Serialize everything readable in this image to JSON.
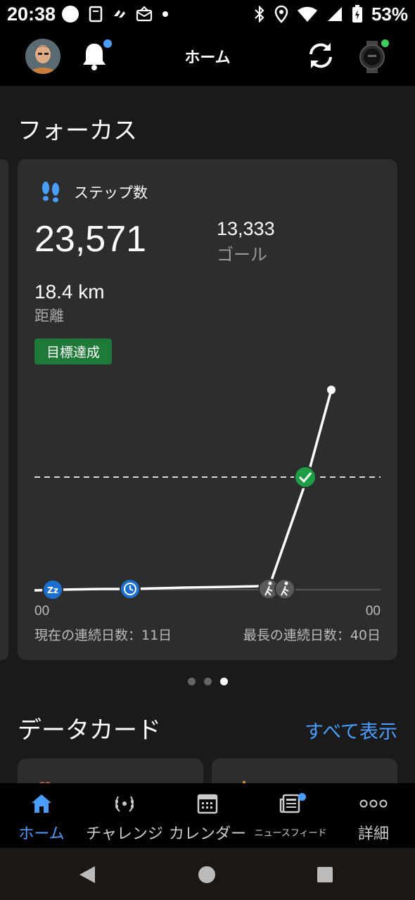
{
  "status_bar": {
    "time": "20:38",
    "battery": "53%"
  },
  "app_bar": {
    "title": "ホーム"
  },
  "focus": {
    "section_title": "フォーカス",
    "card": {
      "label": "ステップ数",
      "steps": "23,571",
      "goal_value": "13,333",
      "goal_label": "ゴール",
      "distance_value": "18.4 km",
      "distance_label": "距離",
      "badge": "目標達成",
      "tick_start": "00",
      "tick_end": "00",
      "current_streak": "現在の連続日数：11日",
      "longest_streak": "最長の連続日数：40日"
    },
    "pager": {
      "count": 3,
      "active": 2
    }
  },
  "data_cards": {
    "section_title": "データカード",
    "see_all": "すべて表示"
  },
  "bottom_nav": [
    {
      "label": "ホーム",
      "icon": "home-icon",
      "active": true
    },
    {
      "label": "チャレンジ",
      "icon": "laurel-icon",
      "active": false
    },
    {
      "label": "カレンダー",
      "icon": "calendar-icon",
      "active": false
    },
    {
      "label": "ニュースフィード",
      "icon": "newsfeed-icon",
      "active": false
    },
    {
      "label": "詳細",
      "icon": "more-icon",
      "active": false
    }
  ],
  "colors": {
    "accent": "#4a9eff",
    "goal_green": "#1f7a3a",
    "background": "#1a1a1a",
    "card": "#2d2d2d"
  }
}
